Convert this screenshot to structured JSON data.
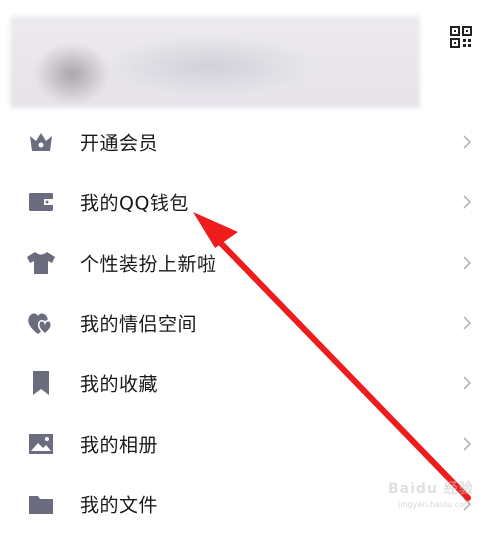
{
  "menu": {
    "items": [
      {
        "label": "开通会员",
        "icon": "crown-icon"
      },
      {
        "label": "我的QQ钱包",
        "icon": "wallet-icon"
      },
      {
        "label": "个性装扮上新啦",
        "icon": "tshirt-icon"
      },
      {
        "label": "我的情侣空间",
        "icon": "hearts-icon"
      },
      {
        "label": "我的收藏",
        "icon": "bookmark-icon"
      },
      {
        "label": "我的相册",
        "icon": "photo-icon"
      },
      {
        "label": "我的文件",
        "icon": "folder-icon"
      }
    ]
  },
  "colors": {
    "icon": "#6b6c7e",
    "text": "#1a1a1a",
    "chevron": "#b5b5bb",
    "annotation_arrow": "#ee1c1c"
  },
  "watermark": {
    "brand": "Baidu 经验",
    "url": "jingyan.baidu.com"
  }
}
